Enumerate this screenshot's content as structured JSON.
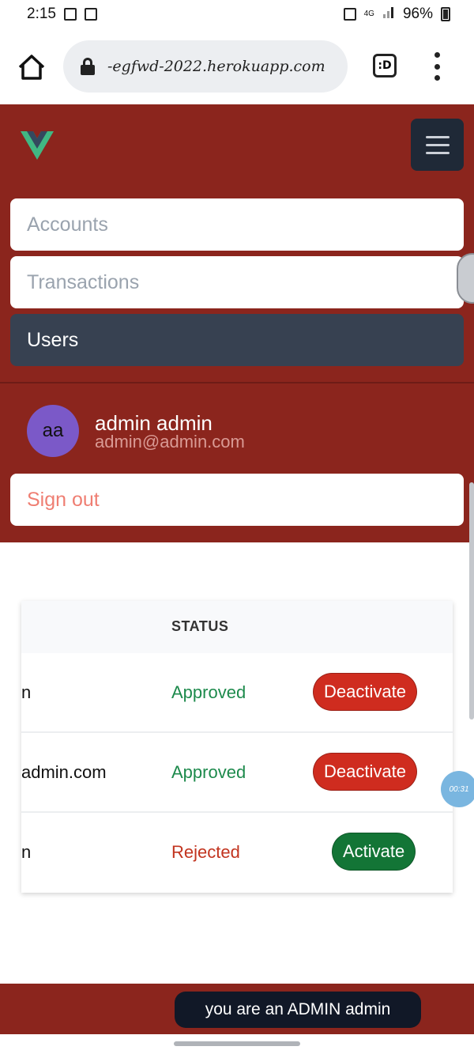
{
  "status_bar": {
    "time": "2:15",
    "network": "4G",
    "battery": "96%"
  },
  "browser": {
    "url": "-egfwd-2022.herokuapp.com",
    "tab_switcher_label": ":D"
  },
  "nav": {
    "items": [
      {
        "label": "Accounts",
        "active": false
      },
      {
        "label": "Transactions",
        "active": false
      },
      {
        "label": "Users",
        "active": true
      }
    ],
    "user": {
      "initials": "aa",
      "name": "admin admin",
      "email": "admin@admin.com"
    },
    "sign_out_label": "Sign out"
  },
  "table": {
    "status_header": "STATUS",
    "rows": [
      {
        "email_fragment": "n",
        "status": "Approved",
        "action": "Deactivate"
      },
      {
        "email_fragment": "admin.com",
        "status": "Approved",
        "action": "Deactivate"
      },
      {
        "email_fragment": "n",
        "status": "Rejected",
        "action": "Activate"
      }
    ]
  },
  "timer_bubble": "00:31",
  "toast": "you are an ADMIN admin",
  "colors": {
    "brand_red": "#8b251d",
    "nav_active": "#374151",
    "approved": "#1d8a4c",
    "rejected": "#c2341f",
    "deactivate_button": "#cf2c1f",
    "activate_button": "#137536"
  }
}
